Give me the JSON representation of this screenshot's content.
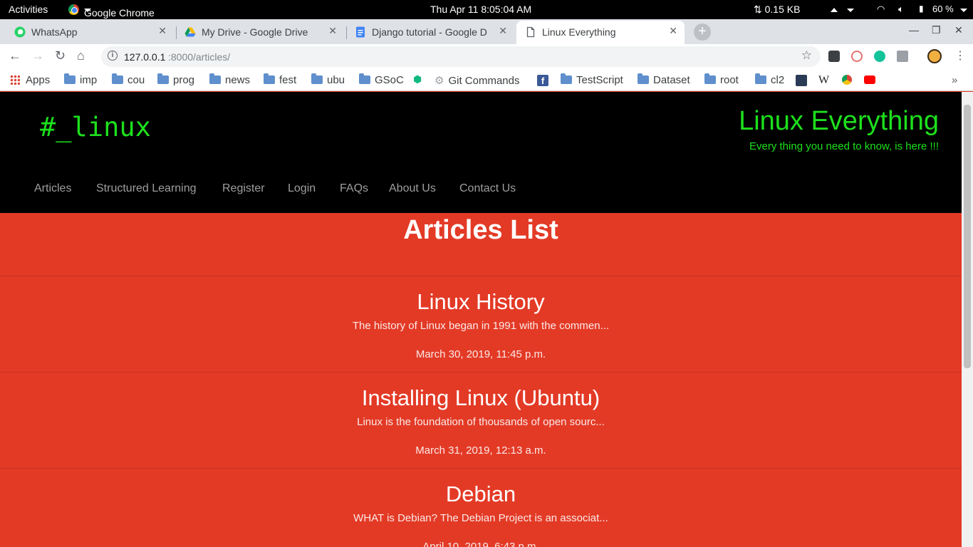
{
  "system_bar": {
    "activities": "Activities",
    "app_name": "Google Chrome",
    "datetime": "Thu Apr 11   8:05:04 AM",
    "network_speed": "⇅ 0.15 KB",
    "battery": "60 %"
  },
  "tabs": [
    {
      "label": "WhatsApp",
      "icon": "whatsapp-icon"
    },
    {
      "label": "My Drive - Google Drive",
      "icon": "google-drive-icon"
    },
    {
      "label": "Django tutorial - Google D",
      "icon": "google-docs-icon"
    },
    {
      "label": "Linux Everything",
      "icon": "page-icon"
    }
  ],
  "address_bar": {
    "host": "127.0.0.1",
    "path": ":8000/articles/"
  },
  "bookmarks": [
    {
      "label": "Apps",
      "icon": "apps-grid-icon"
    },
    {
      "label": "imp",
      "icon": "folder-icon"
    },
    {
      "label": "cou",
      "icon": "folder-icon"
    },
    {
      "label": "prog",
      "icon": "folder-icon"
    },
    {
      "label": "news",
      "icon": "folder-icon"
    },
    {
      "label": "fest",
      "icon": "folder-icon"
    },
    {
      "label": "ubu",
      "icon": "folder-icon"
    },
    {
      "label": "GSoC",
      "icon": "folder-icon"
    },
    {
      "label": "Git Commands",
      "icon": "git-icon"
    },
    {
      "label": "TestScript",
      "icon": "folder-icon"
    },
    {
      "label": "Dataset",
      "icon": "folder-icon"
    },
    {
      "label": "root",
      "icon": "folder-icon"
    },
    {
      "label": "cl2",
      "icon": "folder-icon"
    }
  ],
  "site": {
    "brand": "#_linux",
    "title": "Linux Everything",
    "tagline": "Every thing you need to know, is here !!!",
    "nav": [
      "Articles",
      "Structured Learning",
      "Register",
      "Login",
      "FAQs",
      "About Us",
      "Contact Us"
    ],
    "list_title": "Articles List",
    "articles": [
      {
        "title": "Linux History",
        "snippet": "The history of Linux began in 1991 with the commen...",
        "date": "March 30, 2019, 11:45 p.m."
      },
      {
        "title": "Installing Linux (Ubuntu)",
        "snippet": "Linux is the foundation of thousands of open sourc...",
        "date": "March 31, 2019, 12:13 a.m."
      },
      {
        "title": "Debian",
        "snippet": "WHAT is Debian? The Debian Project is an associat...",
        "date": "April 10, 2019, 6:43 p.m."
      }
    ]
  },
  "colors": {
    "page_background": "#e33a26",
    "header_background": "#000000",
    "brand_green": "#1de01d"
  }
}
